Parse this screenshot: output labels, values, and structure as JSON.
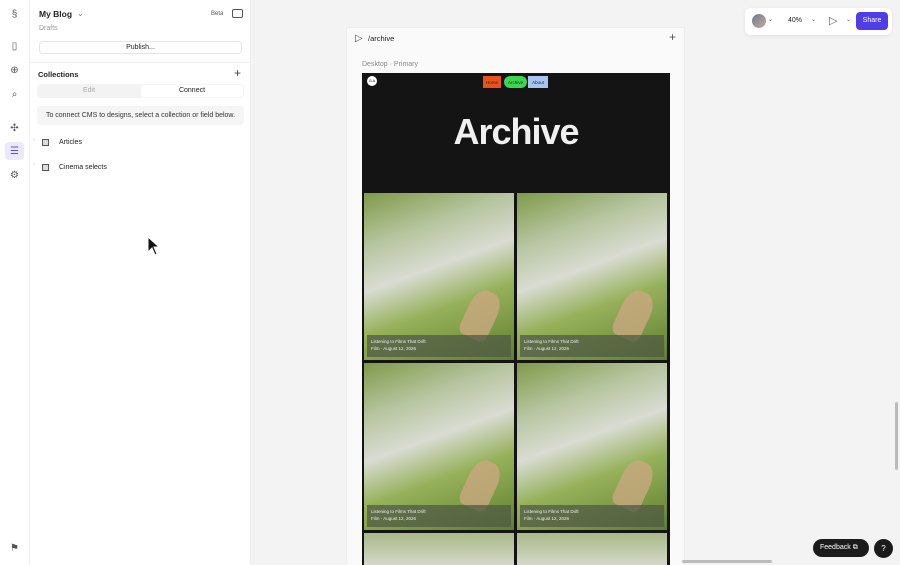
{
  "sidebar": {
    "project": "My Blog",
    "subtitle": "Drafts",
    "beta": "Beta",
    "publish": "Publish...",
    "collections_title": "Collections",
    "tabs": [
      "Edit",
      "Connect"
    ],
    "hint": "To connect CMS to designs, select a collection or field below.",
    "collections": [
      "Articles",
      "Cinema selects"
    ]
  },
  "canvas": {
    "path": "/archive",
    "frame_label": "Desktop · Primary",
    "logo": "G-A",
    "nav": [
      "Home",
      "Archive",
      "About"
    ],
    "heading": "Archive",
    "cards": [
      {
        "title": "Listening to Films That Drift",
        "meta": "Film · August 12, 2026"
      },
      {
        "title": "Listening to Films That Drift",
        "meta": "Film · August 12, 2026"
      },
      {
        "title": "Listening to Films That Drift",
        "meta": "Film · August 12, 2026"
      },
      {
        "title": "Listening to Films That Drift",
        "meta": "Film · August 12, 2026"
      }
    ]
  },
  "toolbar": {
    "zoom": "40%",
    "share": "Share"
  },
  "footer": {
    "feedback": "Feedback",
    "help": "?"
  },
  "colors": {
    "accent": "#4f3ee8",
    "home": "#e8521c",
    "archive": "#3dd64f",
    "about": "#a8c4f4"
  }
}
